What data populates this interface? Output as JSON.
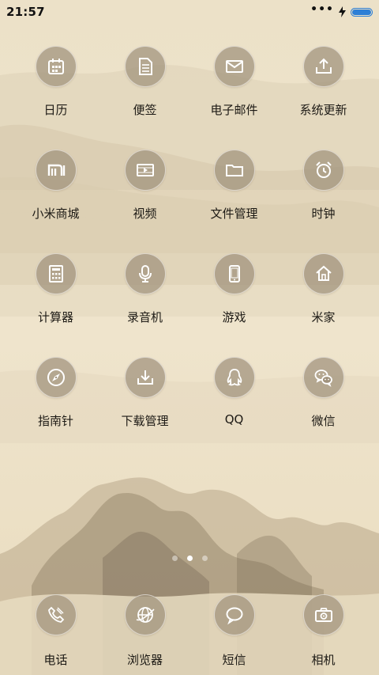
{
  "status": {
    "time": "21:57",
    "battery_level": 1.0
  },
  "apps": [
    {
      "label": "日历",
      "icon": "calendar-icon"
    },
    {
      "label": "便签",
      "icon": "notes-icon"
    },
    {
      "label": "电子邮件",
      "icon": "mail-icon"
    },
    {
      "label": "系统更新",
      "icon": "upload-icon"
    },
    {
      "label": "小米商城",
      "icon": "mi-store-icon"
    },
    {
      "label": "视频",
      "icon": "video-icon"
    },
    {
      "label": "文件管理",
      "icon": "folder-icon"
    },
    {
      "label": "时钟",
      "icon": "alarm-clock-icon"
    },
    {
      "label": "计算器",
      "icon": "calculator-icon"
    },
    {
      "label": "录音机",
      "icon": "microphone-icon"
    },
    {
      "label": "游戏",
      "icon": "phone-device-icon"
    },
    {
      "label": "米家",
      "icon": "home-icon"
    },
    {
      "label": "指南针",
      "icon": "compass-icon"
    },
    {
      "label": "下载管理",
      "icon": "download-icon"
    },
    {
      "label": "QQ",
      "icon": "qq-penguin-icon"
    },
    {
      "label": "微信",
      "icon": "wechat-icon"
    }
  ],
  "page_indicator": {
    "count": 3,
    "active_index": 1
  },
  "dock": [
    {
      "label": "电话",
      "icon": "phone-icon"
    },
    {
      "label": "浏览器",
      "icon": "browser-icon"
    },
    {
      "label": "短信",
      "icon": "chat-bubble-icon"
    },
    {
      "label": "相机",
      "icon": "camera-icon"
    }
  ]
}
